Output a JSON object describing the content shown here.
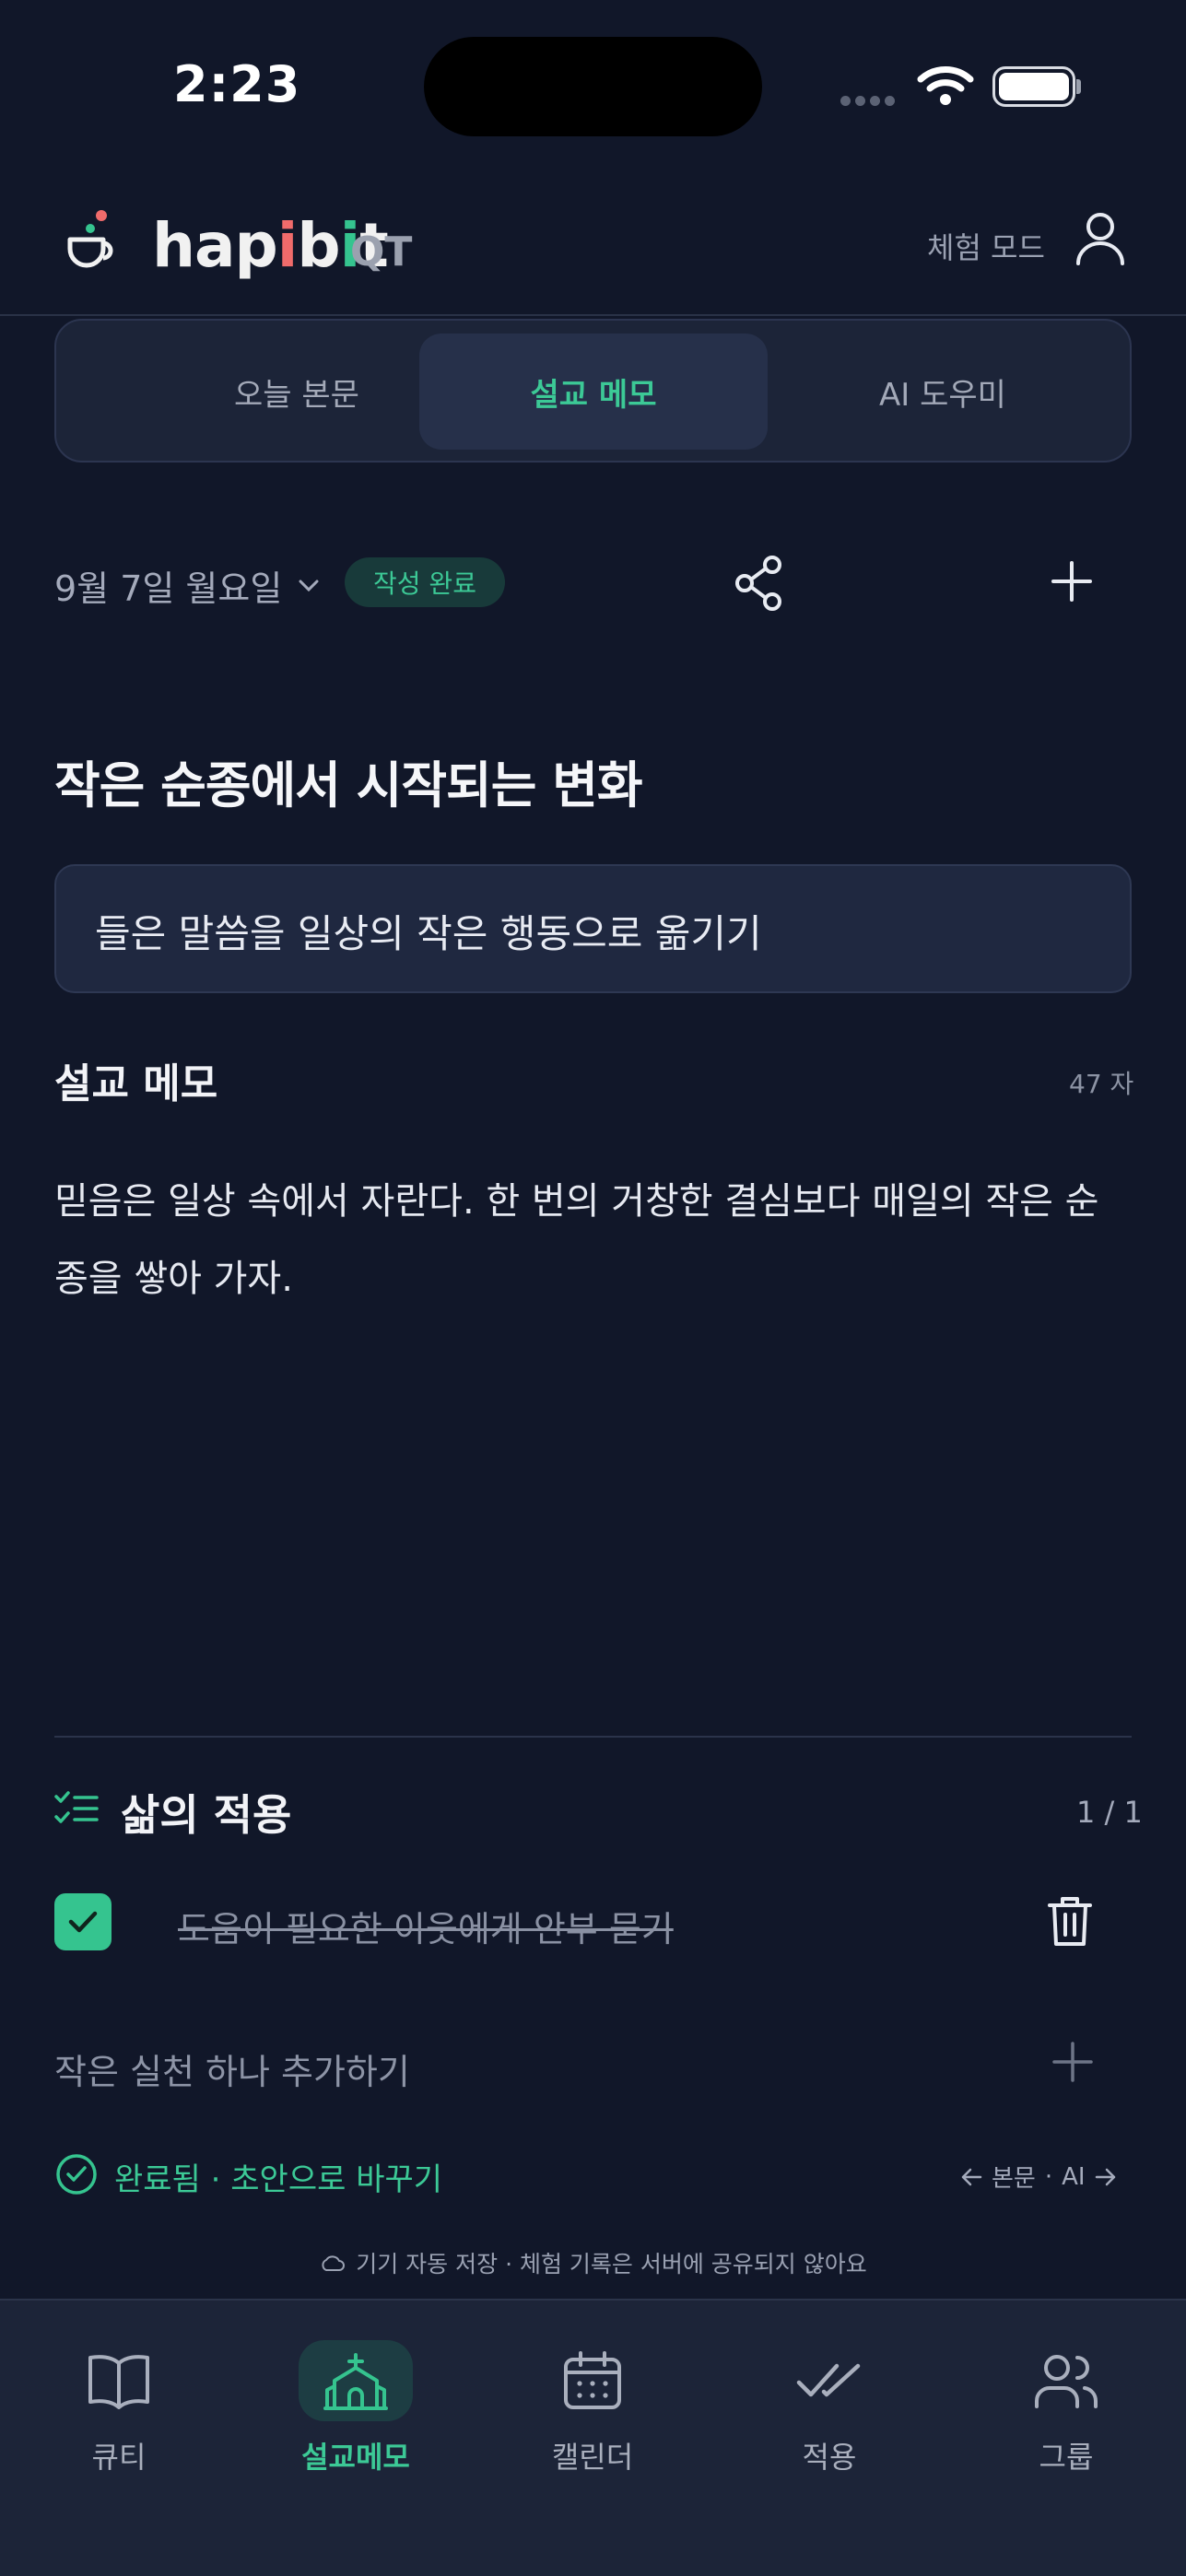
{
  "status_bar": {
    "time": "2:23"
  },
  "header": {
    "brand_parts": [
      "hap",
      "i",
      "b",
      "i",
      "t"
    ],
    "brand_suffix": "QT",
    "trial_mode": "체험 모드"
  },
  "segments": [
    "오늘 본문",
    "설교 메모",
    "AI 도우미"
  ],
  "active_segment": 1,
  "date_row": {
    "date": "9월 7일 월요일",
    "badge": "작성 완료"
  },
  "sermon": {
    "title": "작은 순종에서 시작되는 변화",
    "subtitle": "들은 말씀을 일상의 작은 행동으로 옮기기",
    "memo_label": "설교 메모",
    "memo_count": "47 자",
    "memo_line1": "믿음은 일상 속에서 자란다. 한 번의 거창한 결심보다 매일의 작은 순",
    "memo_line2": "종을 쌓아 가자."
  },
  "application": {
    "label": "삶의 적용",
    "count": "1 / 1",
    "items": [
      {
        "text": "도움이 필요한 이웃에게 안부 묻기",
        "checked": true
      }
    ],
    "add_placeholder": "작은 실천 하나 추가하기",
    "done_text": "완료됨 · 초안으로 바꾸기",
    "nav_prev": "본문",
    "nav_sep": "·",
    "nav_next": "AI"
  },
  "autosave_text": "기기 자동 저장 · 체험 기록은 서버에 공유되지 않아요",
  "tabbar": {
    "active": 1,
    "items": [
      {
        "label": "큐티",
        "icon": "book-icon"
      },
      {
        "label": "설교메모",
        "icon": "church-icon"
      },
      {
        "label": "캘린더",
        "icon": "calendar-icon"
      },
      {
        "label": "적용",
        "icon": "double-check-icon"
      },
      {
        "label": "그룹",
        "icon": "group-icon"
      }
    ]
  },
  "colors": {
    "accent": "#35c48f",
    "background": "#111729",
    "surface": "#1c2438"
  }
}
